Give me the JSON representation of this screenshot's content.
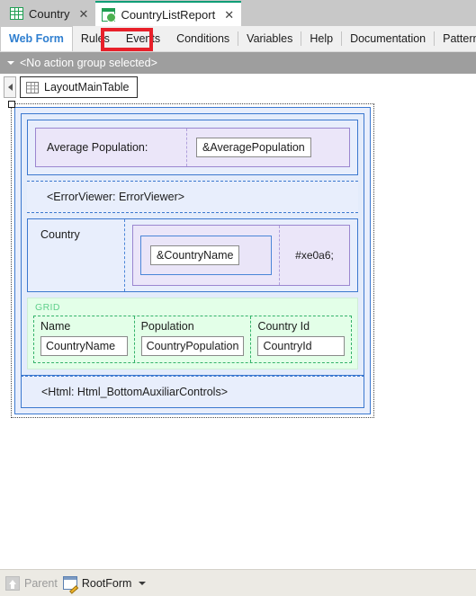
{
  "window": {
    "document_tabs": [
      {
        "label": "Country",
        "icon": "grid-document-icon",
        "close": "✕",
        "active": false
      },
      {
        "label": "CountryListReport",
        "icon": "web-document-icon",
        "close": "✕",
        "active": true
      }
    ],
    "property_tabs": [
      {
        "label": "Web Form",
        "selected": true
      },
      {
        "label": "Rules",
        "selected": false
      },
      {
        "label": "Events",
        "selected": false,
        "highlighted": true
      },
      {
        "label": "Conditions",
        "selected": false
      },
      {
        "label": "Variables",
        "selected": false
      },
      {
        "label": "Help",
        "selected": false
      },
      {
        "label": "Documentation",
        "selected": false
      },
      {
        "label": "Patterns",
        "selected": false
      }
    ],
    "action_group_bar": {
      "text": "<No action group selected>",
      "caret_icon": "chevron-down-icon"
    },
    "breadcrumb": {
      "scroll_icon": "scroll-left-icon",
      "item_label": "LayoutMainTable",
      "item_icon": "table-icon"
    }
  },
  "canvas": {
    "average_population": {
      "label": "Average Population:",
      "value_field": "&AveragePopulation"
    },
    "error_viewer": {
      "text": "<ErrorViewer: ErrorViewer>"
    },
    "country_section": {
      "label": "Country",
      "name_field": "&CountryName",
      "icon_code": "#xe0a6;"
    },
    "grid": {
      "caption": "GRID",
      "columns": [
        {
          "header": "Name",
          "cell": "CountryName"
        },
        {
          "header": "Population",
          "cell": "CountryPopulation"
        },
        {
          "header": "Country Id",
          "cell": "CountryId"
        }
      ]
    },
    "html_bottom": {
      "text": "<Html: Html_BottomAuxiliarControls>"
    }
  },
  "statusbar": {
    "parent": {
      "label": "Parent",
      "icon": "up-arrow-icon",
      "enabled": false
    },
    "root": {
      "label": "RootForm",
      "icon": "form-edit-icon",
      "caret_icon": "chevron-down-icon"
    }
  },
  "colors": {
    "tabstrip_bg": "#c8c8c8",
    "active_tab_accent": "#0f9d77",
    "selected_subtab_text": "#2f7fd0",
    "highlight_red": "#e8202a",
    "action_bar_bg": "#9e9e9e",
    "container_blue_border": "#3b78cf",
    "container_blue_fill": "#e8eefc",
    "purple_border": "#9b86d0",
    "purple_fill": "#ebe6f9",
    "grid_green_border": "#34b36a",
    "grid_green_fill": "#e3ffe8",
    "grid_caption_text": "#5fcf8b",
    "statusbar_bg": "#eceae4"
  }
}
